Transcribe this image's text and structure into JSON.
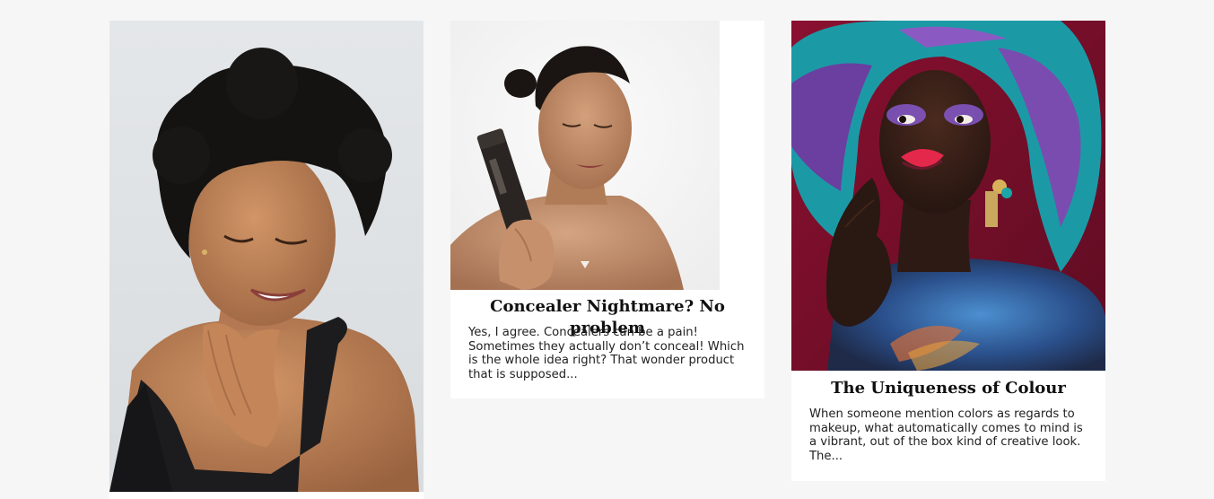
{
  "posts": [
    {
      "image": "portrait-smiling-woman-natural-hair"
    },
    {
      "image": "woman-holding-concealer-tube",
      "title": "Concealer Nightmare? No problem",
      "excerpt": "Yes, I agree. Concealers can be a pain! Sometimes they actually don’t conceal! Which is the whole idea right? That wonder product that is supposed..."
    },
    {
      "image": "woman-colorful-headwrap-glitter-makeup",
      "title": "The Uniqueness of Colour",
      "excerpt": "When someone mention colors as regards to makeup, what automatically comes to mind is a vibrant, out of the box kind of creative look. The..."
    }
  ],
  "colors": {
    "page_background": "#f6f6f6",
    "card_background": "#ffffff",
    "title_text": "#111111",
    "body_text": "#222222"
  }
}
